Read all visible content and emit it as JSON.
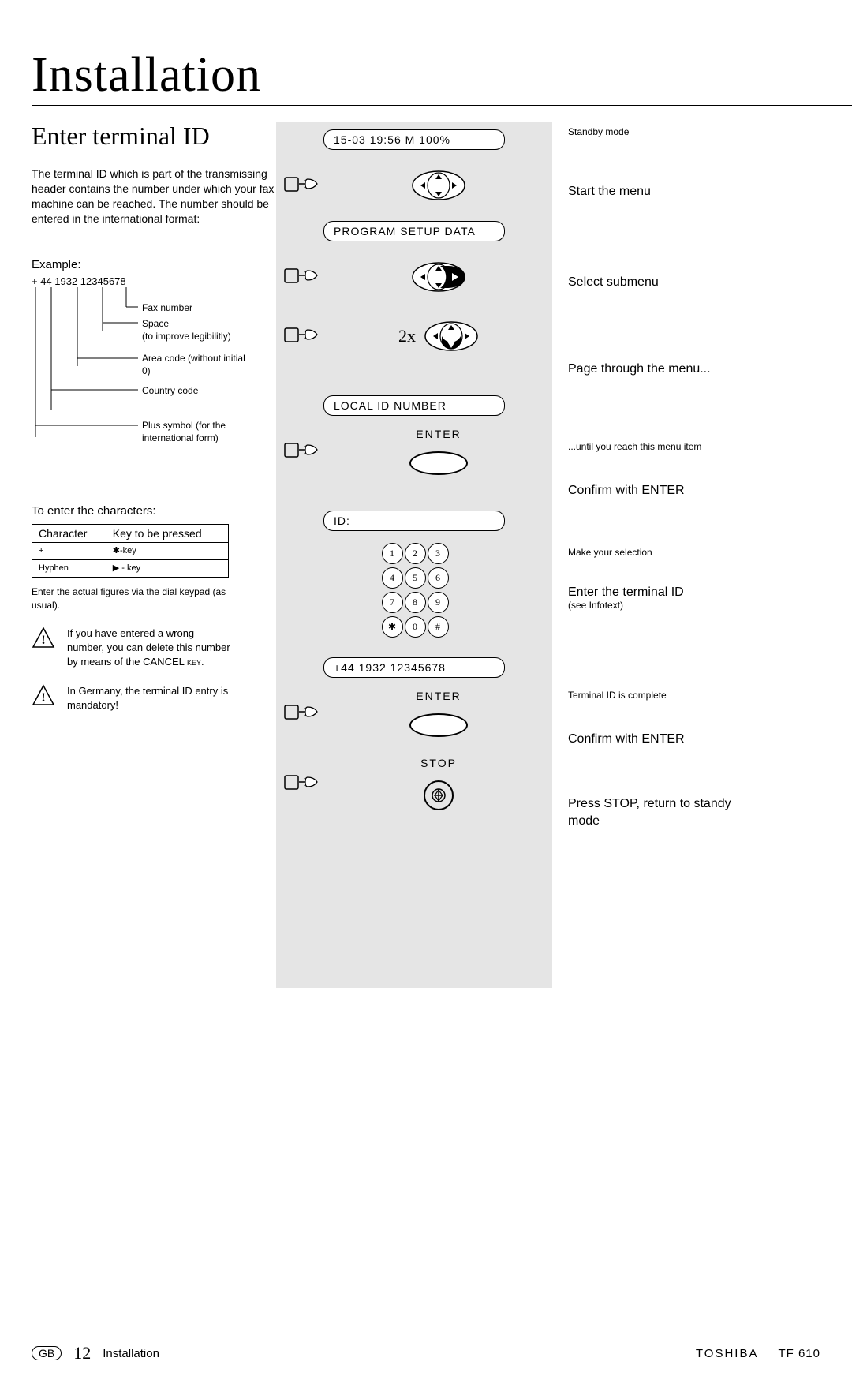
{
  "title": "Installation",
  "subtitle": "Enter terminal ID",
  "intro": "The terminal ID which is part of the transmissing header contains the number under which your fax machine can be reached. The number should be entered in the international format:",
  "example_label": "Example:",
  "example_number": "+ 44 1932   12345678",
  "tree": {
    "fax": "Fax number",
    "space1": "Space",
    "space2": "(to improve legibilitly)",
    "area1": "Area code (without initial",
    "area2": "0)",
    "country": "Country code",
    "plus1": "Plus symbol (for the",
    "plus2": "international form)"
  },
  "enter_label": "To enter the characters:",
  "char_table": {
    "h1": "Character",
    "h2": "Key to be pressed",
    "r1c1": "+",
    "r1c2": "✱-key",
    "r2c1": "Hyphen",
    "r2c2": "▶  - key"
  },
  "dial_note": "Enter the actual figures via the dial keypad (as usual).",
  "warn1a": "If you have entered a wrong number, you can delete this number by means of the",
  "warn1b": "CANCEL key.",
  "warn2": "In Germany, the terminal ID entry is mandatory!",
  "mid": {
    "lcd1": "15-03 19:56  M 100%",
    "lcd2": "PROGRAM SETUP DATA",
    "mult": "2x",
    "lcd3": "LOCAL ID NUMBER",
    "enter": "ENTER",
    "lcd4": "ID:",
    "lcd5": "+44 1932 12345678",
    "stop": "STOP",
    "keys": [
      "1",
      "2",
      "3",
      "4",
      "5",
      "6",
      "7",
      "8",
      "9",
      "✱",
      "0",
      "#"
    ]
  },
  "right": {
    "r1": "Standby mode",
    "r2": "Start the menu",
    "r3": "Select submenu",
    "r4": "Page through the menu...",
    "r5": "...until you reach this menu item",
    "r6": "Confirm with ENTER",
    "r7": "Make your selection",
    "r8": "Enter the terminal ID",
    "r8b": "(see Infotext)",
    "r9": "Terminal ID is complete",
    "r10": "Confirm with ENTER",
    "r11": "Press STOP, return to standy mode"
  },
  "footer": {
    "gb": "GB",
    "page": "12",
    "section": "Installation",
    "brand": "TOSHIBA",
    "model": "TF 610"
  }
}
